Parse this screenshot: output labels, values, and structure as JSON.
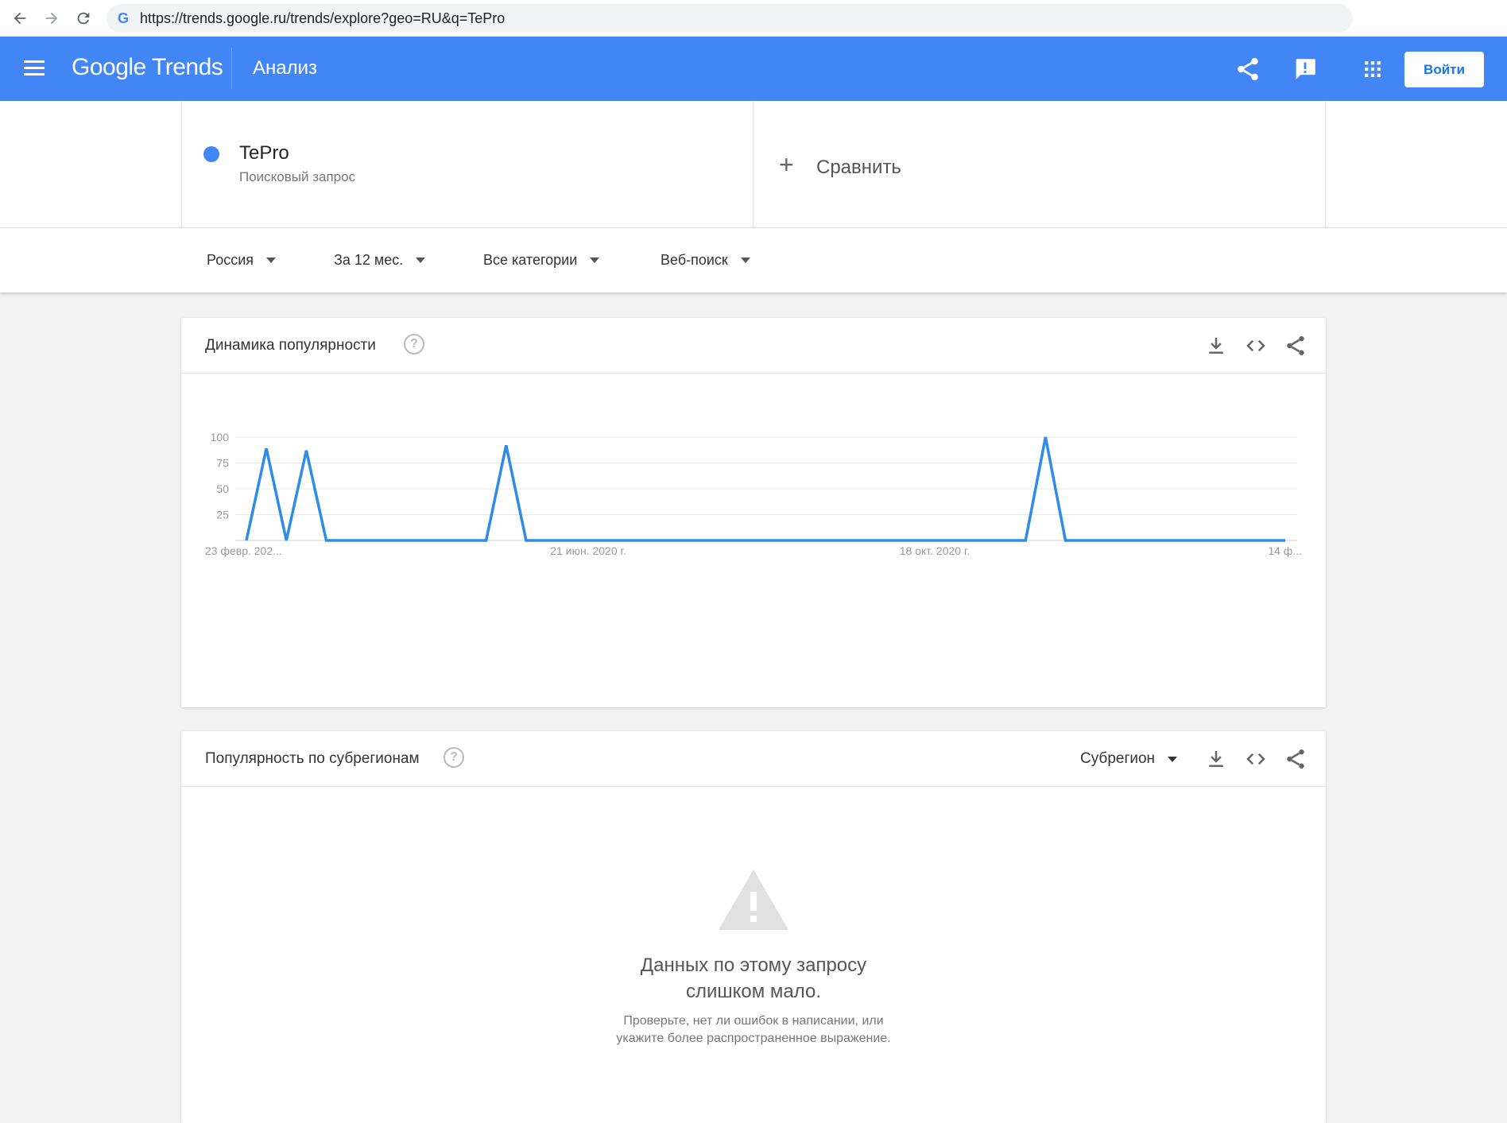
{
  "browser": {
    "url": "https://trends.google.ru/trends/explore?geo=RU&q=TePro"
  },
  "header": {
    "logo": "Google Trends",
    "title": "Анализ",
    "signin_label": "Войти"
  },
  "term": {
    "name": "TePro",
    "type": "Поисковый запрос",
    "color": "#4285f4"
  },
  "compare": {
    "label": "Сравнить"
  },
  "filters": {
    "region": "Россия",
    "period": "За 12 мес.",
    "category": "Все категории",
    "search_type": "Веб-поиск"
  },
  "trend_card": {
    "title": "Динамика популярности"
  },
  "chart_data": {
    "type": "line",
    "x_tick_labels": [
      "23 февр. 202...",
      "21 июн. 2020 г.",
      "18 окт. 2020 г.",
      "14 ф..."
    ],
    "y_ticks": [
      25,
      50,
      75,
      100
    ],
    "ylim": [
      0,
      100
    ],
    "grid": true,
    "series": [
      {
        "color": "#2f8be6",
        "values": [
          0,
          89,
          0,
          87,
          0,
          0,
          0,
          0,
          0,
          0,
          0,
          0,
          0,
          92,
          0,
          0,
          0,
          0,
          0,
          0,
          0,
          0,
          0,
          0,
          0,
          0,
          0,
          0,
          0,
          0,
          0,
          0,
          0,
          0,
          0,
          0,
          0,
          0,
          0,
          0,
          100,
          0,
          0,
          0,
          0,
          0,
          0,
          0,
          0,
          0,
          0,
          0,
          0
        ]
      }
    ]
  },
  "subregion_card": {
    "title": "Популярность по субрегионам",
    "select_label": "Субрегион",
    "empty_title_line1": "Данных по этому запросу",
    "empty_title_line2": "слишком мало.",
    "empty_sub_line1": "Проверьте, нет ли ошибок в написании, или",
    "empty_sub_line2": "укажите более распространенное выражение."
  }
}
